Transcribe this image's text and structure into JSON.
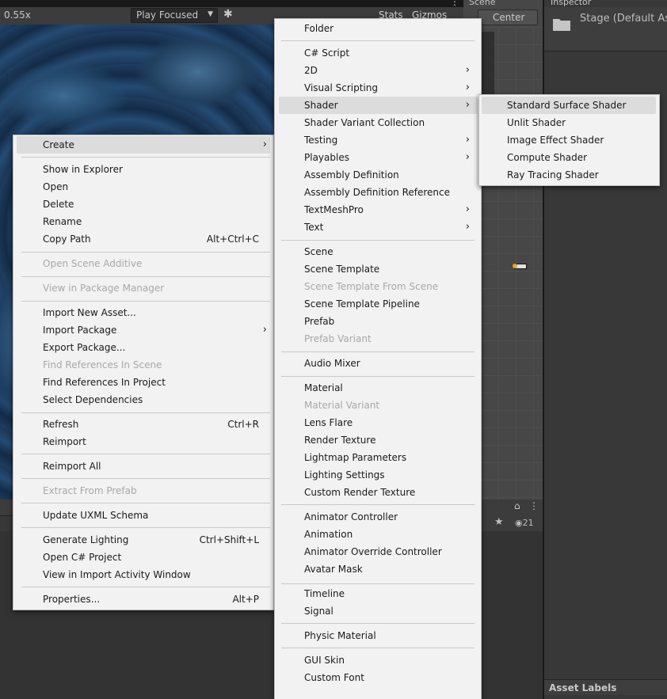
{
  "game_toolbar": {
    "zoom": "0.55x",
    "play_mode": "Play Focused",
    "stats": "Stats",
    "gizmos": "Gizmos",
    "play_mode_icon": "chevron-down-icon",
    "bug_icon": "bug-icon"
  },
  "scene": {
    "tab": "Scene",
    "pivot": "Center"
  },
  "inspector": {
    "tab": "Inspector",
    "title": "Stage (Default As",
    "asset_labels": "Asset Labels",
    "visible_count": "21"
  },
  "context_menu": {
    "items": [
      {
        "label": "Create",
        "submenu": true,
        "highlighted": true
      },
      {
        "label": "Show in Explorer"
      },
      {
        "label": "Open"
      },
      {
        "label": "Delete"
      },
      {
        "label": "Rename"
      },
      {
        "label": "Copy Path",
        "shortcut": "Alt+Ctrl+C"
      },
      {
        "label": "Open Scene Additive",
        "disabled": true
      },
      {
        "label": "View in Package Manager",
        "disabled": true
      },
      {
        "label": "Import New Asset..."
      },
      {
        "label": "Import Package",
        "submenu": true
      },
      {
        "label": "Export Package..."
      },
      {
        "label": "Find References In Scene",
        "disabled": true
      },
      {
        "label": "Find References In Project"
      },
      {
        "label": "Select Dependencies"
      },
      {
        "label": "Refresh",
        "shortcut": "Ctrl+R"
      },
      {
        "label": "Reimport"
      },
      {
        "label": "Reimport All"
      },
      {
        "label": "Extract From Prefab",
        "disabled": true
      },
      {
        "label": "Update UXML Schema"
      },
      {
        "label": "Generate Lighting",
        "shortcut": "Ctrl+Shift+L"
      },
      {
        "label": "Open C# Project"
      },
      {
        "label": "View in Import Activity Window"
      },
      {
        "label": "Properties...",
        "shortcut": "Alt+P"
      }
    ]
  },
  "create_menu": {
    "items": [
      {
        "label": "Folder"
      },
      {
        "label": "C# Script"
      },
      {
        "label": "2D",
        "submenu": true
      },
      {
        "label": "Visual Scripting",
        "submenu": true
      },
      {
        "label": "Shader",
        "submenu": true,
        "highlighted": true
      },
      {
        "label": "Shader Variant Collection"
      },
      {
        "label": "Testing",
        "submenu": true
      },
      {
        "label": "Playables",
        "submenu": true
      },
      {
        "label": "Assembly Definition"
      },
      {
        "label": "Assembly Definition Reference"
      },
      {
        "label": "TextMeshPro",
        "submenu": true
      },
      {
        "label": "Text",
        "submenu": true
      },
      {
        "label": "Scene"
      },
      {
        "label": "Scene Template"
      },
      {
        "label": "Scene Template From Scene",
        "disabled": true
      },
      {
        "label": "Scene Template Pipeline"
      },
      {
        "label": "Prefab"
      },
      {
        "label": "Prefab Variant",
        "disabled": true
      },
      {
        "label": "Audio Mixer"
      },
      {
        "label": "Material"
      },
      {
        "label": "Material Variant",
        "disabled": true
      },
      {
        "label": "Lens Flare"
      },
      {
        "label": "Render Texture"
      },
      {
        "label": "Lightmap Parameters"
      },
      {
        "label": "Lighting Settings"
      },
      {
        "label": "Custom Render Texture"
      },
      {
        "label": "Animator Controller"
      },
      {
        "label": "Animation"
      },
      {
        "label": "Animator Override Controller"
      },
      {
        "label": "Avatar Mask"
      },
      {
        "label": "Timeline"
      },
      {
        "label": "Signal"
      },
      {
        "label": "Physic Material"
      },
      {
        "label": "GUI Skin"
      },
      {
        "label": "Custom Font"
      }
    ]
  },
  "shader_menu": {
    "items": [
      {
        "label": "Standard Surface Shader",
        "highlighted": true
      },
      {
        "label": "Unlit Shader"
      },
      {
        "label": "Image Effect Shader"
      },
      {
        "label": "Compute Shader"
      },
      {
        "label": "Ray Tracing Shader"
      }
    ]
  }
}
